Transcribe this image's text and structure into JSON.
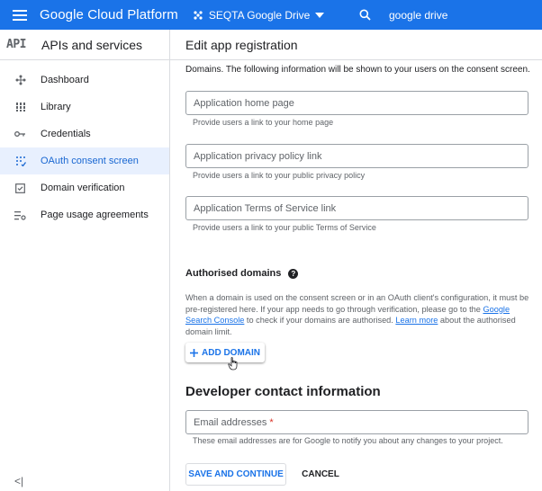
{
  "topbar": {
    "brand": "Google Cloud Platform",
    "project": "SEQTA Google Drive",
    "search_value": "google drive",
    "accent": "#1a73e8"
  },
  "sidebar": {
    "logo": "API",
    "title": "APIs and services",
    "items": [
      {
        "label": "Dashboard",
        "icon": "dashboard-icon"
      },
      {
        "label": "Library",
        "icon": "library-icon"
      },
      {
        "label": "Credentials",
        "icon": "key-icon"
      },
      {
        "label": "OAuth consent screen",
        "icon": "consent-icon",
        "active": true
      },
      {
        "label": "Domain verification",
        "icon": "checkbox-icon"
      },
      {
        "label": "Page usage agreements",
        "icon": "settings-list-icon"
      }
    ],
    "collapse": "<|"
  },
  "main": {
    "header": "Edit app registration",
    "intro": "Domains. The following information will be shown to your users on the consent screen.",
    "fields": [
      {
        "placeholder": "Application home page",
        "hint": "Provide users a link to your home page"
      },
      {
        "placeholder": "Application privacy policy link",
        "hint": "Provide users a link to your public privacy policy"
      },
      {
        "placeholder": "Application Terms of Service link",
        "hint": "Provide users a link to your public Terms of Service"
      }
    ],
    "authorised": {
      "title": "Authorised domains",
      "para_1": "When a domain is used on the consent screen or in an OAuth client's configuration, it must be pre-registered here. If your app needs to go through verification, please go to the ",
      "link_1": "Google Search Console",
      "para_2": " to check if your domains are authorised. ",
      "link_2": "Learn more",
      "para_3": " about the authorised domain limit.",
      "add_label": "ADD DOMAIN"
    },
    "developer": {
      "title": "Developer contact information",
      "email_placeholder": "Email addresses",
      "required_mark": "*",
      "email_hint": "These email addresses are for Google to notify you about any changes to your project."
    },
    "save_label": "SAVE AND CONTINUE",
    "cancel_label": "CANCEL"
  }
}
